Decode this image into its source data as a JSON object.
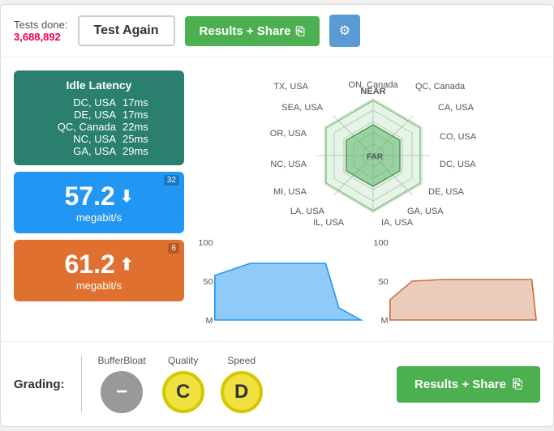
{
  "header": {
    "tests_done_label": "Tests done:",
    "tests_done_count": "3,688,892",
    "test_again_label": "Test Again",
    "results_share_label": "Results + Share",
    "gear_icon": "⚙"
  },
  "latency": {
    "title": "Idle Latency",
    "rows": [
      {
        "location": "DC, USA",
        "value": "17ms"
      },
      {
        "location": "DE, USA",
        "value": "17ms"
      },
      {
        "location": "QC, Canada",
        "value": "22ms"
      },
      {
        "location": "NC, USA",
        "value": "25ms"
      },
      {
        "location": "GA, USA",
        "value": "29ms"
      }
    ]
  },
  "download": {
    "value": "57.2",
    "unit": "megabit/s",
    "badge": "32",
    "icon": "↓"
  },
  "upload": {
    "value": "61.2",
    "unit": "megabit/s",
    "badge": "6",
    "icon": "↑"
  },
  "radar": {
    "near_label": "NEAR",
    "far_label": "FAR",
    "locations": [
      "ON, Canada",
      "QC, Canada",
      "TX, USA",
      "CA, USA",
      "CO, USA",
      "DC, USA",
      "DE, USA",
      "GA, USA",
      "IA, USA",
      "IL, USA",
      "LA, USA",
      "MI, USA",
      "NC, USA",
      "OR, USA",
      "SEA, USA"
    ]
  },
  "chart_download": {
    "top_label": "100",
    "mid_label": "50",
    "bot_label": "M"
  },
  "chart_upload": {
    "top_label": "100",
    "mid_label": "50",
    "bot_label": "M"
  },
  "grading": {
    "label": "Grading:",
    "bufferbloat_label": "BufferBloat",
    "quality_label": "Quality",
    "speed_label": "Speed",
    "bufferbloat_grade": "−",
    "quality_grade": "C",
    "speed_grade": "D",
    "results_share_label": "Results + Share"
  },
  "colors": {
    "green": "#4caf50",
    "blue": "#2196f3",
    "orange": "#e07030",
    "teal": "#2a7f6f",
    "radar_fill": "rgba(90,180,100,0.4)",
    "radar_stroke": "#4a9a50"
  }
}
